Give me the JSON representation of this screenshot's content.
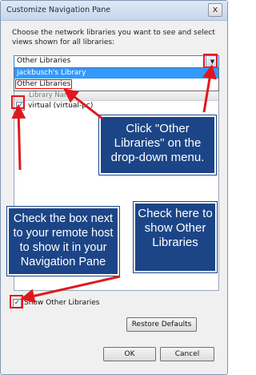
{
  "window": {
    "title": "Customize Navigation Pane",
    "close_glyph": "x"
  },
  "instruction": "Choose the network libraries you want to see and select views shown for all libraries:",
  "library_select": {
    "selected": "Other Libraries",
    "options": [
      "jackbusch's Library",
      "Other Libraries"
    ]
  },
  "list": {
    "column_header": "Library Name",
    "rows": [
      {
        "label": "virtual (virtual-pc)",
        "checked": true
      }
    ]
  },
  "show_other_libraries": {
    "label": "Show Other Libraries",
    "checked": true
  },
  "buttons": {
    "restore_defaults": "Restore Defaults",
    "ok": "OK",
    "cancel": "Cancel"
  },
  "callouts": {
    "click_other": "Click \"Other Libraries\" on the drop-down menu.",
    "check_host": "Check the box next to your remote host to show it in your Navigation Pane",
    "check_show_other": "Check here to show Other Libraries"
  },
  "colors": {
    "accent_red": "#e0181e",
    "callout_bg": "#1c4587",
    "selection_blue": "#3399ff"
  }
}
